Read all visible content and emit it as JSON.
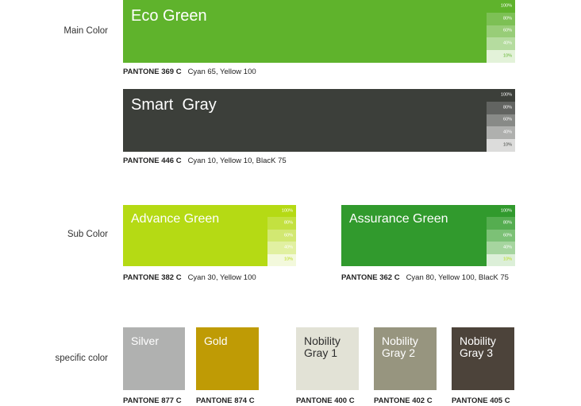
{
  "labels": {
    "main": "Main Color",
    "sub": "Sub Color",
    "specific": "specific color"
  },
  "tint_levels": [
    "100%",
    "80%",
    "60%",
    "40%",
    "10%"
  ],
  "main_colors": [
    {
      "name": "Eco Green",
      "pantone": "PANTONE 369 C",
      "spec": "Cyan 65, Yellow 100",
      "hex": "#5fb32c",
      "tints": [
        "#5fb32c",
        "#7dc055",
        "#98cd78",
        "#b5dc9f",
        "#e3f2d9"
      ],
      "tint_text": [
        "#ffffff",
        "#ffffff",
        "#ffffff",
        "#ffffff",
        "#5fb32c"
      ]
    },
    {
      "name": "Smart  Gray",
      "pantone": "PANTONE 446 C",
      "spec": "Cyan 10, Yellow 10, BlacK 75",
      "hex": "#3c3f3a",
      "tints": [
        "#3c3f3a",
        "#626461",
        "#888a87",
        "#afb0ae",
        "#dcdcdb"
      ],
      "tint_text": [
        "#ffffff",
        "#ffffff",
        "#ffffff",
        "#ffffff",
        "#3c3f3a"
      ]
    }
  ],
  "sub_colors": [
    {
      "name": "Advance Green",
      "pantone": "PANTONE 382 C",
      "spec": "Cyan 30, Yellow 100",
      "hex": "#b5da14",
      "tints": [
        "#b5da14",
        "#c3e140",
        "#d2e872",
        "#e1f0a1",
        "#f3f9dc"
      ],
      "tint_text": [
        "#ffffff",
        "#ffffff",
        "#ffffff",
        "#ffffff",
        "#b5da14"
      ]
    },
    {
      "name": "Assurance Green",
      "pantone": "PANTONE 362 C",
      "spec": "Cyan 80, Yellow 100, BlacK 75",
      "hex": "#319a2d",
      "tints": [
        "#319a2d",
        "#55ad50",
        "#7cc176",
        "#a6d59f",
        "#dcefd8"
      ],
      "tint_text": [
        "#ffffff",
        "#ffffff",
        "#ffffff",
        "#ffffff",
        "#b5da14"
      ]
    }
  ],
  "specific_colors": [
    {
      "name": "Silver",
      "pantone": "PANTONE 877 C",
      "hex": "#b0b1b0",
      "text": "#ffffff"
    },
    {
      "name": "Gold",
      "pantone": "PANTONE 874 C",
      "hex": "#bf9b05",
      "text": "#ffffff"
    },
    {
      "name": "Nobility Gray 1",
      "pantone": "PANTONE 400 C",
      "hex": "#e2e2d6",
      "text": "#2e2e2e"
    },
    {
      "name": "Nobility Gray 2",
      "pantone": "PANTONE 402 C",
      "hex": "#97957f",
      "text": "#ffffff"
    },
    {
      "name": "Nobility Gray 3",
      "pantone": "PANTONE 405 C",
      "hex": "#4c433a",
      "text": "#ffffff"
    }
  ]
}
